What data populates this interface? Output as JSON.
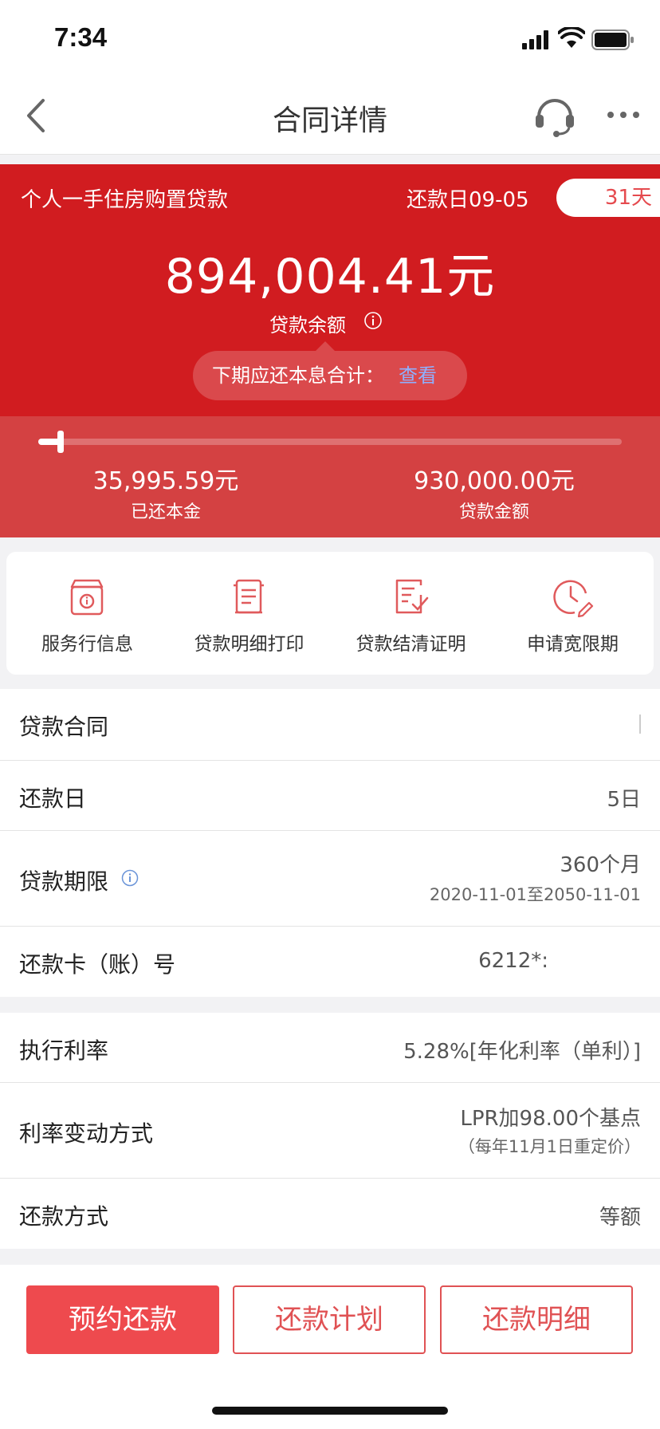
{
  "status_bar": {
    "time": "7:34"
  },
  "nav": {
    "title": "合同详情"
  },
  "hero": {
    "loan_type": "个人一手住房购置贷款",
    "repay_date": "还款日09-05",
    "days_left": "31天",
    "balance": "894,004.41元",
    "balance_label": "贷款余额",
    "next_payment_label": "下期应还本息合计：",
    "next_payment_link": "查看"
  },
  "progress": {
    "fraction": 0.0387,
    "paid_amount": "35,995.59元",
    "paid_label": "已还本金",
    "loan_amount": "930,000.00元",
    "loan_label": "贷款金额"
  },
  "services": [
    {
      "label": "服务行信息",
      "icon": "bank-info-icon"
    },
    {
      "label": "贷款明细打印",
      "icon": "print-document-icon"
    },
    {
      "label": "贷款结清证明",
      "icon": "certificate-check-icon"
    },
    {
      "label": "申请宽限期",
      "icon": "clock-edit-icon"
    }
  ],
  "details": {
    "contract_label": "贷款合同",
    "repay_day_label": "还款日",
    "repay_day_value": "5日",
    "term_label": "贷款期限",
    "term_value": "360个月",
    "term_range": "2020-11-01至2050-11-01",
    "card_label": "还款卡（账）号",
    "card_value": "6212*:",
    "rate_label": "执行利率",
    "rate_value": "5.28%[年化利率（单利）]",
    "rate_change_label": "利率变动方式",
    "rate_change_value": "LPR加98.00个基点",
    "rate_change_note": "（每年11月1日重定价）",
    "method_label": "还款方式",
    "method_value": "等额"
  },
  "actions": {
    "book_repay": "预约还款",
    "repay_plan": "还款计划",
    "repay_detail": "还款明细"
  },
  "colors": {
    "accent_red": "#d11c20",
    "button_red": "#ee4a4e",
    "link_blue": "#8fb0ff"
  }
}
